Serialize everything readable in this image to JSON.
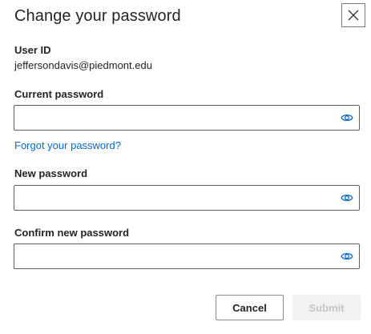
{
  "dialog": {
    "title": "Change your password",
    "close_icon": "close-icon"
  },
  "user": {
    "label": "User ID",
    "value": "jeffersondavis@piedmont.edu"
  },
  "current_password": {
    "label": "Current password",
    "value": "",
    "icon": "eye-icon"
  },
  "forgot_link": "Forgot your password?",
  "new_password": {
    "label": "New password",
    "value": "",
    "icon": "eye-icon"
  },
  "confirm_password": {
    "label": "Confirm new password",
    "value": "",
    "icon": "eye-icon"
  },
  "actions": {
    "cancel_label": "Cancel",
    "submit_label": "Submit",
    "submit_enabled": false
  },
  "colors": {
    "accent": "#0a6ac2",
    "text": "#252423",
    "border": "#605e5c",
    "disabled_bg": "#f3f2f1",
    "disabled_text": "#c8c6c4"
  }
}
